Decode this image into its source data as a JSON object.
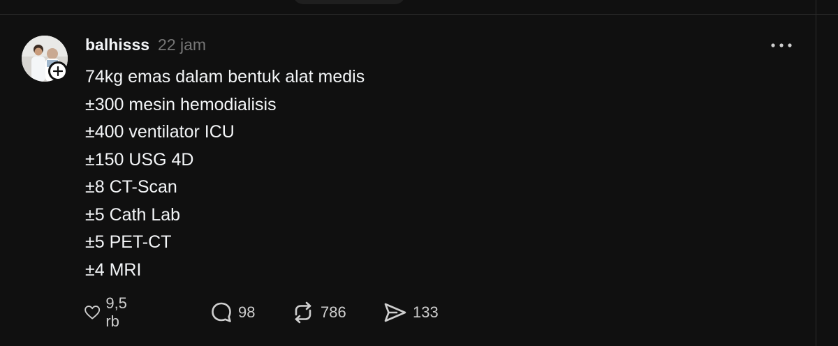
{
  "post": {
    "username": "balhisss",
    "time": "22 jam",
    "lines": [
      "74kg emas dalam bentuk alat medis",
      "±300 mesin hemodialisis",
      "±400 ventilator ICU",
      "±150 USG 4D",
      "±8 CT-Scan",
      "±5 Cath Lab",
      "±5 PET-CT",
      "±4 MRI"
    ]
  },
  "actions": {
    "like_count": "9,5 rb",
    "reply_count": "98",
    "repost_count": "786",
    "share_count": "133"
  },
  "icons": {
    "more": "more-horizontal-icon",
    "like": "heart-icon",
    "reply": "comment-bubble-icon",
    "repost": "repost-arrows-icon",
    "share": "send-icon",
    "follow": "plus-icon"
  },
  "colors": {
    "background": "#101010",
    "text": "#f3f5f7",
    "muted": "#777777"
  }
}
